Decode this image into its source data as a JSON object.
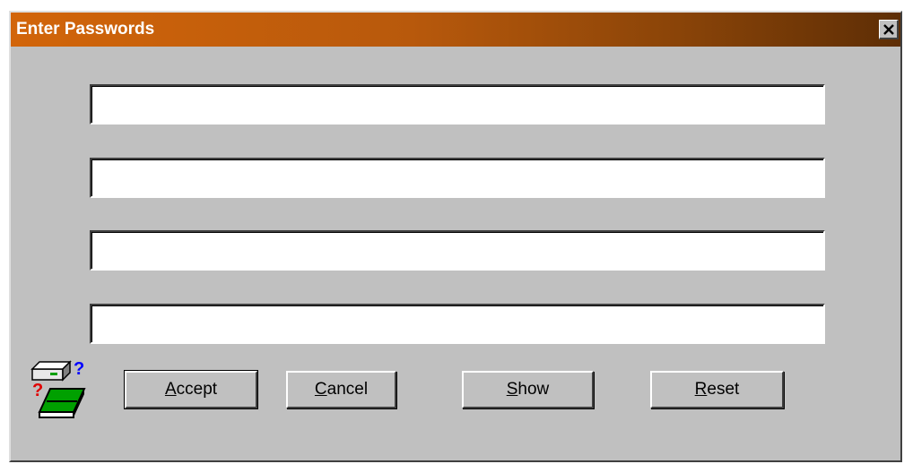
{
  "window": {
    "title": "Enter Passwords",
    "close_icon": "close-x-icon",
    "title_gradient": [
      "#d2650a",
      "#5e2e05"
    ],
    "background": "#c0c0c0"
  },
  "fields": [
    {
      "value": "",
      "placeholder": ""
    },
    {
      "value": "",
      "placeholder": ""
    },
    {
      "value": "",
      "placeholder": ""
    },
    {
      "value": "",
      "placeholder": ""
    }
  ],
  "app_icon": "password-drive-icon",
  "buttons": {
    "accept": {
      "mnemonic": "A",
      "rest": "ccept"
    },
    "cancel": {
      "mnemonic": "C",
      "rest": "ancel"
    },
    "show": {
      "mnemonic": "S",
      "rest": "how"
    },
    "reset": {
      "mnemonic": "R",
      "rest": "eset"
    }
  }
}
